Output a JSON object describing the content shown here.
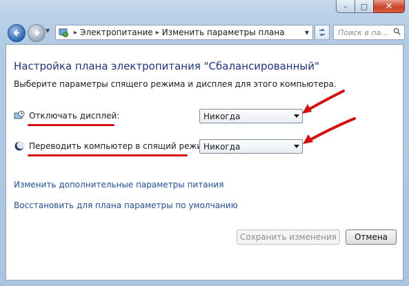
{
  "window": {
    "caption_buttons": {
      "minimize": "–",
      "maximize": "□",
      "close": "✕"
    }
  },
  "navigation": {
    "back_icon": "back-arrow-icon",
    "forward_icon": "forward-arrow-icon"
  },
  "address_bar": {
    "separator": "▸",
    "breadcrumb": [
      "Электропитание",
      "Изменить параметры плана"
    ]
  },
  "search": {
    "placeholder": "Поиск в па..."
  },
  "page": {
    "title": "Настройка плана электропитания \"Сбалансированный\"",
    "subtitle": "Выберите параметры спящего режима и дисплея для этого компьютера.",
    "settings": [
      {
        "label": "Отключать дисплей:",
        "value": "Никогда",
        "icon": "monitor-clock-icon"
      },
      {
        "label": "Переводить компьютер в спящий режим:",
        "value": "Никогда",
        "icon": "moon-sleep-icon"
      }
    ],
    "links": [
      "Изменить дополнительные параметры питания",
      "Восстановить для плана параметры по умолчанию"
    ],
    "buttons": {
      "save": "Сохранить изменения",
      "cancel": "Отмена"
    }
  },
  "colors": {
    "annotation": "#d40f0f",
    "link": "#1c4f9c",
    "title": "#1e3287"
  }
}
